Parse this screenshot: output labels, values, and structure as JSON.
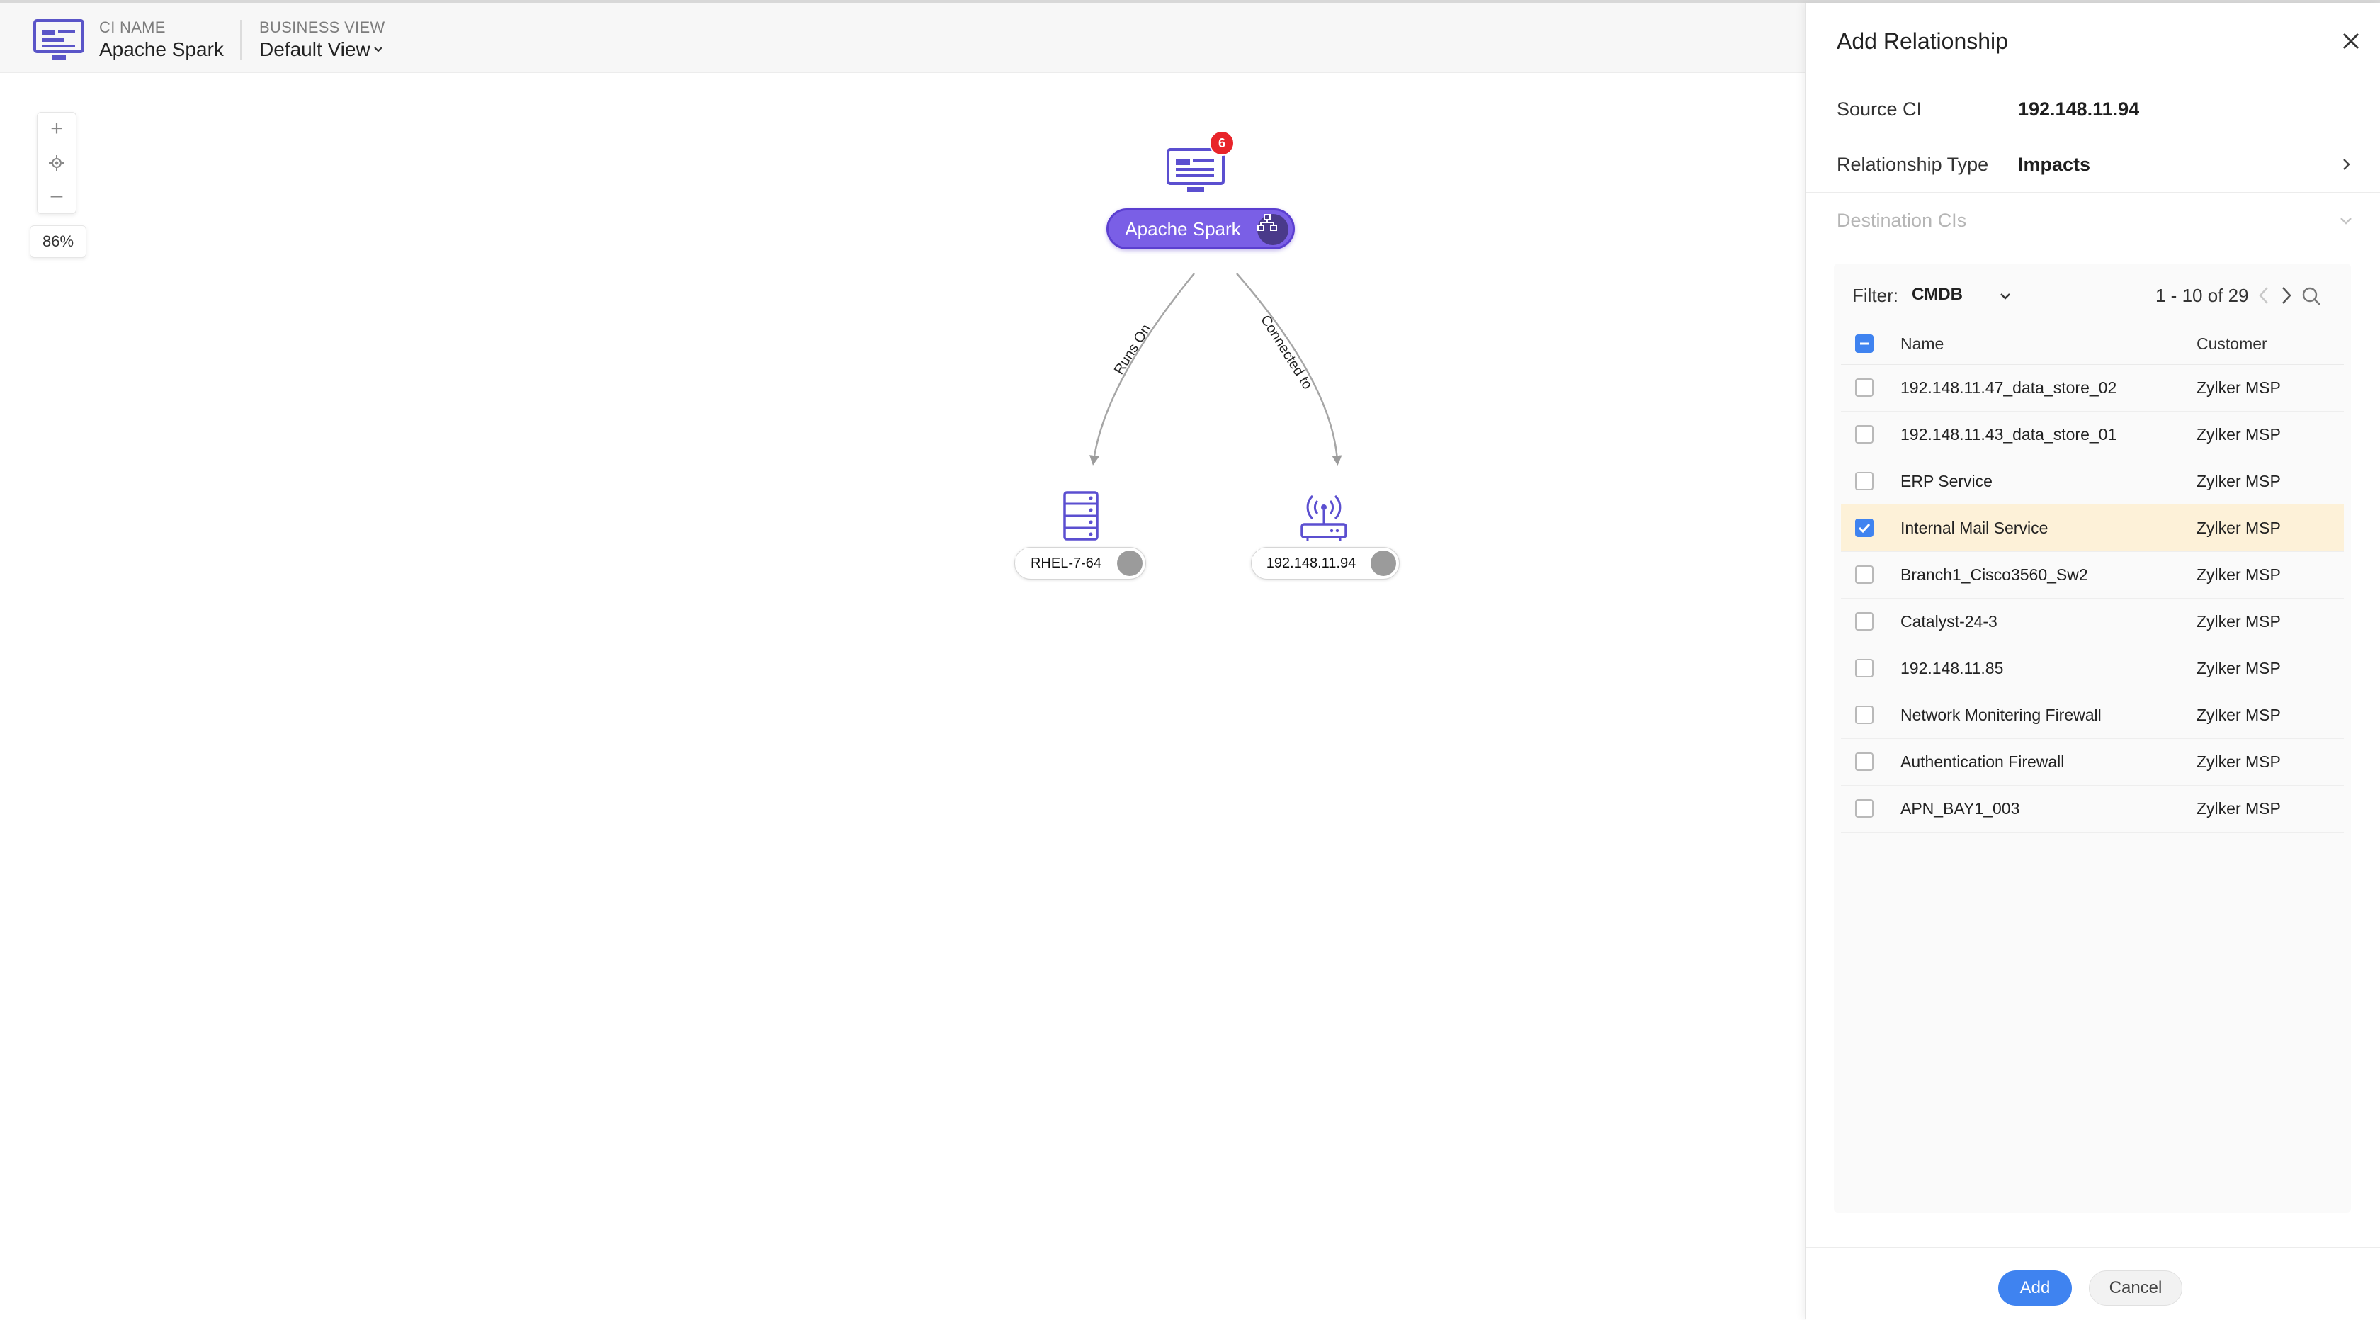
{
  "header": {
    "ci_name_label": "CI NAME",
    "ci_name": "Apache Spark",
    "business_view_label": "BUSINESS VIEW",
    "business_view": "Default View"
  },
  "zoom": {
    "zoom_in": "+",
    "zoom_out": "–",
    "level": "86%"
  },
  "graph": {
    "root": {
      "label": "Apache Spark",
      "badge": "6"
    },
    "children": [
      {
        "label": "RHEL-7-64",
        "relation": "Runs On",
        "icon": "server-icon"
      },
      {
        "label": "192.148.11.94",
        "relation": "Connected to",
        "icon": "router-icon"
      }
    ]
  },
  "panel": {
    "title": "Add Relationship",
    "source_ci_label": "Source CI",
    "source_ci_value": "192.148.11.94",
    "relationship_type_label": "Relationship Type",
    "relationship_type_value": "Impacts",
    "destination_label": "Destination CIs",
    "filter_label": "Filter:",
    "filter_value": "CMDB",
    "pager": "1 - 10 of 29",
    "columns": {
      "name": "Name",
      "customer": "Customer"
    },
    "rows": [
      {
        "name": "192.148.11.47_data_store_02",
        "customer": "Zylker MSP",
        "checked": false
      },
      {
        "name": "192.148.11.43_data_store_01",
        "customer": "Zylker MSP",
        "checked": false
      },
      {
        "name": "ERP Service",
        "customer": "Zylker MSP",
        "checked": false
      },
      {
        "name": "Internal Mail Service",
        "customer": "Zylker MSP",
        "checked": true
      },
      {
        "name": "Branch1_Cisco3560_Sw2",
        "customer": "Zylker MSP",
        "checked": false
      },
      {
        "name": "Catalyst-24-3",
        "customer": "Zylker MSP",
        "checked": false
      },
      {
        "name": "192.148.11.85",
        "customer": "Zylker MSP",
        "checked": false
      },
      {
        "name": "Network Monitering Firewall",
        "customer": "Zylker MSP",
        "checked": false
      },
      {
        "name": "Authentication Firewall",
        "customer": "Zylker MSP",
        "checked": false
      },
      {
        "name": "APN_BAY1_003",
        "customer": "Zylker MSP",
        "checked": false
      }
    ],
    "add_label": "Add",
    "cancel_label": "Cancel"
  },
  "colors": {
    "accent_purple": "#7a5fe6",
    "primary_blue": "#3f83f0",
    "badge_red": "#e8242a",
    "row_highlight": "#fdf1d8"
  }
}
